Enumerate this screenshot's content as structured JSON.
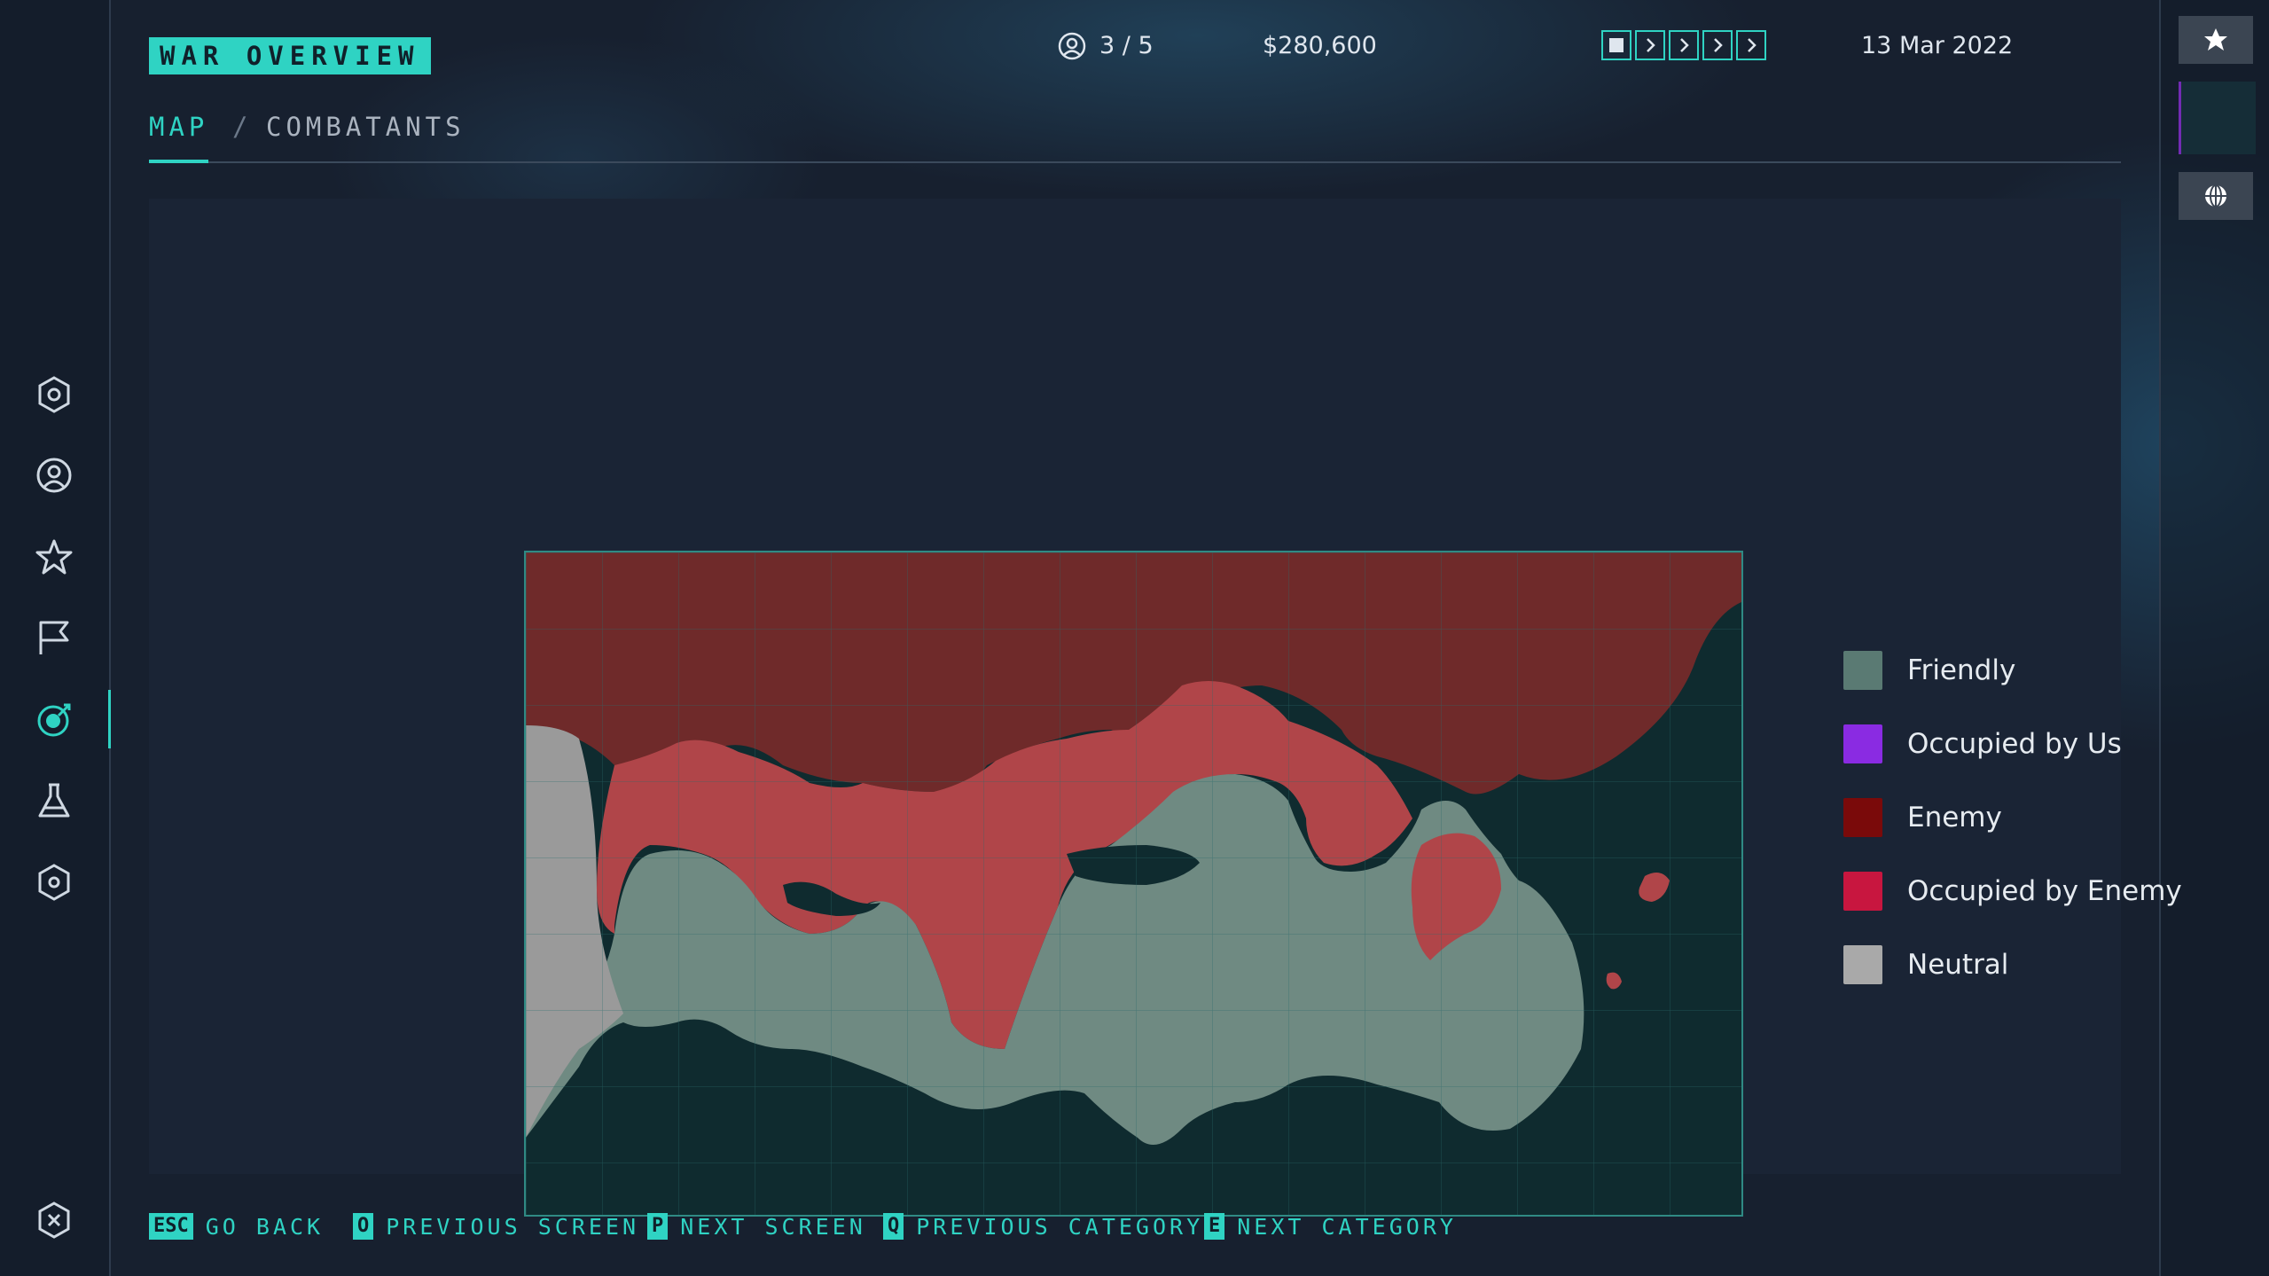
{
  "header": {
    "title": "WAR OVERVIEW",
    "player_count": "3 / 5",
    "money": "$280,600",
    "date": "13 Mar 2022"
  },
  "tabs": [
    {
      "label": "MAP",
      "active": true
    },
    {
      "label": "COMBATANTS",
      "active": false
    }
  ],
  "tab_separator": "/",
  "nav_items": [
    {
      "icon": "hexagon-gear-icon"
    },
    {
      "icon": "user-circle-icon"
    },
    {
      "icon": "star-icon"
    },
    {
      "icon": "flag-icon"
    },
    {
      "icon": "target-icon",
      "active": true
    },
    {
      "icon": "flask-icon"
    },
    {
      "icon": "hexagon-settings-icon"
    }
  ],
  "exit_icon": "close-hexagon-icon",
  "right_rail": {
    "top_icon": "star-icon",
    "bottom_icon": "globe-icon"
  },
  "speed_controls": [
    "pause",
    "speed-1",
    "speed-2",
    "speed-3",
    "speed-4"
  ],
  "legend": [
    {
      "label": "Friendly",
      "color": "#5a7a73"
    },
    {
      "label": "Occupied by Us",
      "color": "#8a2be2"
    },
    {
      "label": "Enemy",
      "color": "#7a0a0a"
    },
    {
      "label": "Occupied by Enemy",
      "color": "#c8163f"
    },
    {
      "label": "Neutral",
      "color": "#a9a9a9"
    }
  ],
  "map_colors": {
    "sea": "#0f2b2f",
    "enemy": "#6f2a2a",
    "occupied_by_enemy": "#b04549",
    "friendly": "#6f8a82",
    "neutral": "#9a9a9a",
    "grid": "#2a6b6a"
  },
  "footer_hotkeys": [
    {
      "key": "ESC",
      "label": "GO BACK"
    },
    {
      "key": "O",
      "label": "PREVIOUS SCREEN"
    },
    {
      "key": "P",
      "label": "NEXT SCREEN"
    },
    {
      "key": "Q",
      "label": "PREVIOUS CATEGORY"
    },
    {
      "key": "E",
      "label": "NEXT CATEGORY"
    }
  ],
  "accent_color": "#2fd3c3"
}
